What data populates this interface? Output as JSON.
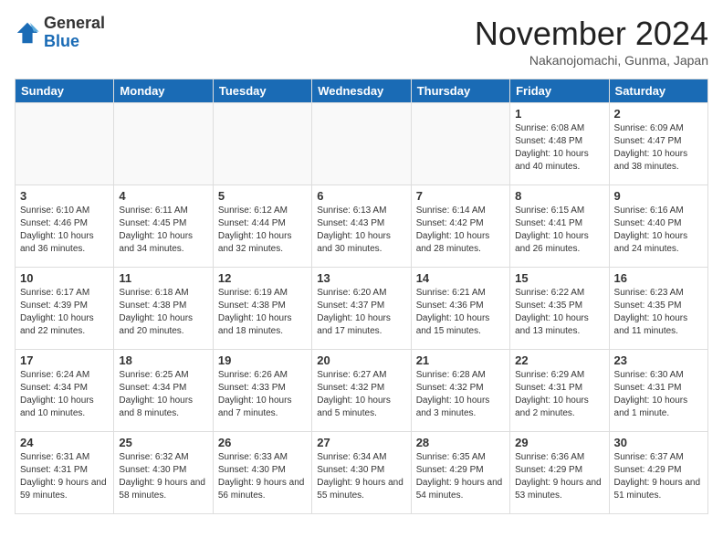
{
  "logo": {
    "general": "General",
    "blue": "Blue"
  },
  "title": "November 2024",
  "location": "Nakanojomachi, Gunma, Japan",
  "days_of_week": [
    "Sunday",
    "Monday",
    "Tuesday",
    "Wednesday",
    "Thursday",
    "Friday",
    "Saturday"
  ],
  "weeks": [
    [
      {
        "day": "",
        "info": ""
      },
      {
        "day": "",
        "info": ""
      },
      {
        "day": "",
        "info": ""
      },
      {
        "day": "",
        "info": ""
      },
      {
        "day": "",
        "info": ""
      },
      {
        "day": "1",
        "info": "Sunrise: 6:08 AM\nSunset: 4:48 PM\nDaylight: 10 hours and 40 minutes."
      },
      {
        "day": "2",
        "info": "Sunrise: 6:09 AM\nSunset: 4:47 PM\nDaylight: 10 hours and 38 minutes."
      }
    ],
    [
      {
        "day": "3",
        "info": "Sunrise: 6:10 AM\nSunset: 4:46 PM\nDaylight: 10 hours and 36 minutes."
      },
      {
        "day": "4",
        "info": "Sunrise: 6:11 AM\nSunset: 4:45 PM\nDaylight: 10 hours and 34 minutes."
      },
      {
        "day": "5",
        "info": "Sunrise: 6:12 AM\nSunset: 4:44 PM\nDaylight: 10 hours and 32 minutes."
      },
      {
        "day": "6",
        "info": "Sunrise: 6:13 AM\nSunset: 4:43 PM\nDaylight: 10 hours and 30 minutes."
      },
      {
        "day": "7",
        "info": "Sunrise: 6:14 AM\nSunset: 4:42 PM\nDaylight: 10 hours and 28 minutes."
      },
      {
        "day": "8",
        "info": "Sunrise: 6:15 AM\nSunset: 4:41 PM\nDaylight: 10 hours and 26 minutes."
      },
      {
        "day": "9",
        "info": "Sunrise: 6:16 AM\nSunset: 4:40 PM\nDaylight: 10 hours and 24 minutes."
      }
    ],
    [
      {
        "day": "10",
        "info": "Sunrise: 6:17 AM\nSunset: 4:39 PM\nDaylight: 10 hours and 22 minutes."
      },
      {
        "day": "11",
        "info": "Sunrise: 6:18 AM\nSunset: 4:38 PM\nDaylight: 10 hours and 20 minutes."
      },
      {
        "day": "12",
        "info": "Sunrise: 6:19 AM\nSunset: 4:38 PM\nDaylight: 10 hours and 18 minutes."
      },
      {
        "day": "13",
        "info": "Sunrise: 6:20 AM\nSunset: 4:37 PM\nDaylight: 10 hours and 17 minutes."
      },
      {
        "day": "14",
        "info": "Sunrise: 6:21 AM\nSunset: 4:36 PM\nDaylight: 10 hours and 15 minutes."
      },
      {
        "day": "15",
        "info": "Sunrise: 6:22 AM\nSunset: 4:35 PM\nDaylight: 10 hours and 13 minutes."
      },
      {
        "day": "16",
        "info": "Sunrise: 6:23 AM\nSunset: 4:35 PM\nDaylight: 10 hours and 11 minutes."
      }
    ],
    [
      {
        "day": "17",
        "info": "Sunrise: 6:24 AM\nSunset: 4:34 PM\nDaylight: 10 hours and 10 minutes."
      },
      {
        "day": "18",
        "info": "Sunrise: 6:25 AM\nSunset: 4:34 PM\nDaylight: 10 hours and 8 minutes."
      },
      {
        "day": "19",
        "info": "Sunrise: 6:26 AM\nSunset: 4:33 PM\nDaylight: 10 hours and 7 minutes."
      },
      {
        "day": "20",
        "info": "Sunrise: 6:27 AM\nSunset: 4:32 PM\nDaylight: 10 hours and 5 minutes."
      },
      {
        "day": "21",
        "info": "Sunrise: 6:28 AM\nSunset: 4:32 PM\nDaylight: 10 hours and 3 minutes."
      },
      {
        "day": "22",
        "info": "Sunrise: 6:29 AM\nSunset: 4:31 PM\nDaylight: 10 hours and 2 minutes."
      },
      {
        "day": "23",
        "info": "Sunrise: 6:30 AM\nSunset: 4:31 PM\nDaylight: 10 hours and 1 minute."
      }
    ],
    [
      {
        "day": "24",
        "info": "Sunrise: 6:31 AM\nSunset: 4:31 PM\nDaylight: 9 hours and 59 minutes."
      },
      {
        "day": "25",
        "info": "Sunrise: 6:32 AM\nSunset: 4:30 PM\nDaylight: 9 hours and 58 minutes."
      },
      {
        "day": "26",
        "info": "Sunrise: 6:33 AM\nSunset: 4:30 PM\nDaylight: 9 hours and 56 minutes."
      },
      {
        "day": "27",
        "info": "Sunrise: 6:34 AM\nSunset: 4:30 PM\nDaylight: 9 hours and 55 minutes."
      },
      {
        "day": "28",
        "info": "Sunrise: 6:35 AM\nSunset: 4:29 PM\nDaylight: 9 hours and 54 minutes."
      },
      {
        "day": "29",
        "info": "Sunrise: 6:36 AM\nSunset: 4:29 PM\nDaylight: 9 hours and 53 minutes."
      },
      {
        "day": "30",
        "info": "Sunrise: 6:37 AM\nSunset: 4:29 PM\nDaylight: 9 hours and 51 minutes."
      }
    ]
  ]
}
